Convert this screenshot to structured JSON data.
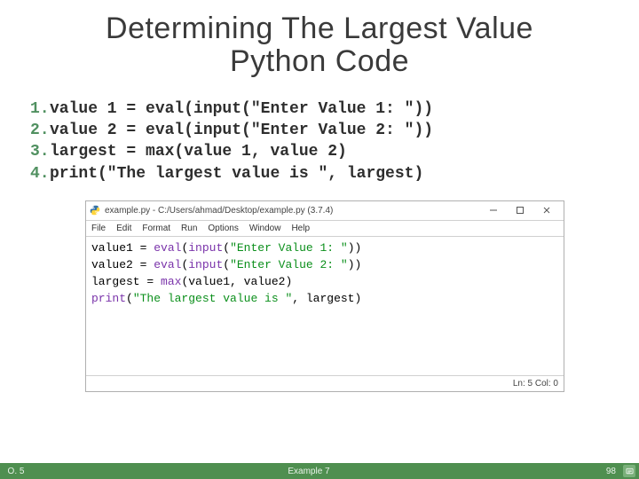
{
  "heading_line1": "Determining The Largest Value",
  "heading_line2": "Python Code",
  "code_lines": [
    {
      "n": "1.",
      "t": "value 1 = eval(input(\"Enter Value 1: \"))"
    },
    {
      "n": "2.",
      "t": "value 2 = eval(input(\"Enter Value 2: \"))"
    },
    {
      "n": "3.",
      "t": "largest = max(value 1, value 2)"
    },
    {
      "n": "4.",
      "t": "print(\"The largest value is \", largest)"
    }
  ],
  "ide": {
    "title": "example.py - C:/Users/ahmad/Desktop/example.py (3.7.4)",
    "menus": [
      "File",
      "Edit",
      "Format",
      "Run",
      "Options",
      "Window",
      "Help"
    ],
    "status": "Ln: 5  Col: 0",
    "lines": [
      [
        {
          "c": "t-id",
          "t": "value1 "
        },
        {
          "c": "t-op",
          "t": "= "
        },
        {
          "c": "t-fn",
          "t": "eval"
        },
        {
          "c": "t-op",
          "t": "("
        },
        {
          "c": "t-fn",
          "t": "input"
        },
        {
          "c": "t-op",
          "t": "("
        },
        {
          "c": "t-str",
          "t": "\"Enter Value 1: \""
        },
        {
          "c": "t-op",
          "t": "))"
        }
      ],
      [
        {
          "c": "t-id",
          "t": "value2 "
        },
        {
          "c": "t-op",
          "t": "= "
        },
        {
          "c": "t-fn",
          "t": "eval"
        },
        {
          "c": "t-op",
          "t": "("
        },
        {
          "c": "t-fn",
          "t": "input"
        },
        {
          "c": "t-op",
          "t": "("
        },
        {
          "c": "t-str",
          "t": "\"Enter Value 2: \""
        },
        {
          "c": "t-op",
          "t": "))"
        }
      ],
      [
        {
          "c": "t-id",
          "t": "largest "
        },
        {
          "c": "t-op",
          "t": "= "
        },
        {
          "c": "t-fn",
          "t": "max"
        },
        {
          "c": "t-op",
          "t": "(value1, value2)"
        }
      ],
      [
        {
          "c": "t-fn",
          "t": "print"
        },
        {
          "c": "t-op",
          "t": "("
        },
        {
          "c": "t-str",
          "t": "\"The largest value is \""
        },
        {
          "c": "t-op",
          "t": ", largest)"
        }
      ]
    ]
  },
  "footer": {
    "left": "O. 5",
    "center": "Example 7",
    "right": "98"
  }
}
